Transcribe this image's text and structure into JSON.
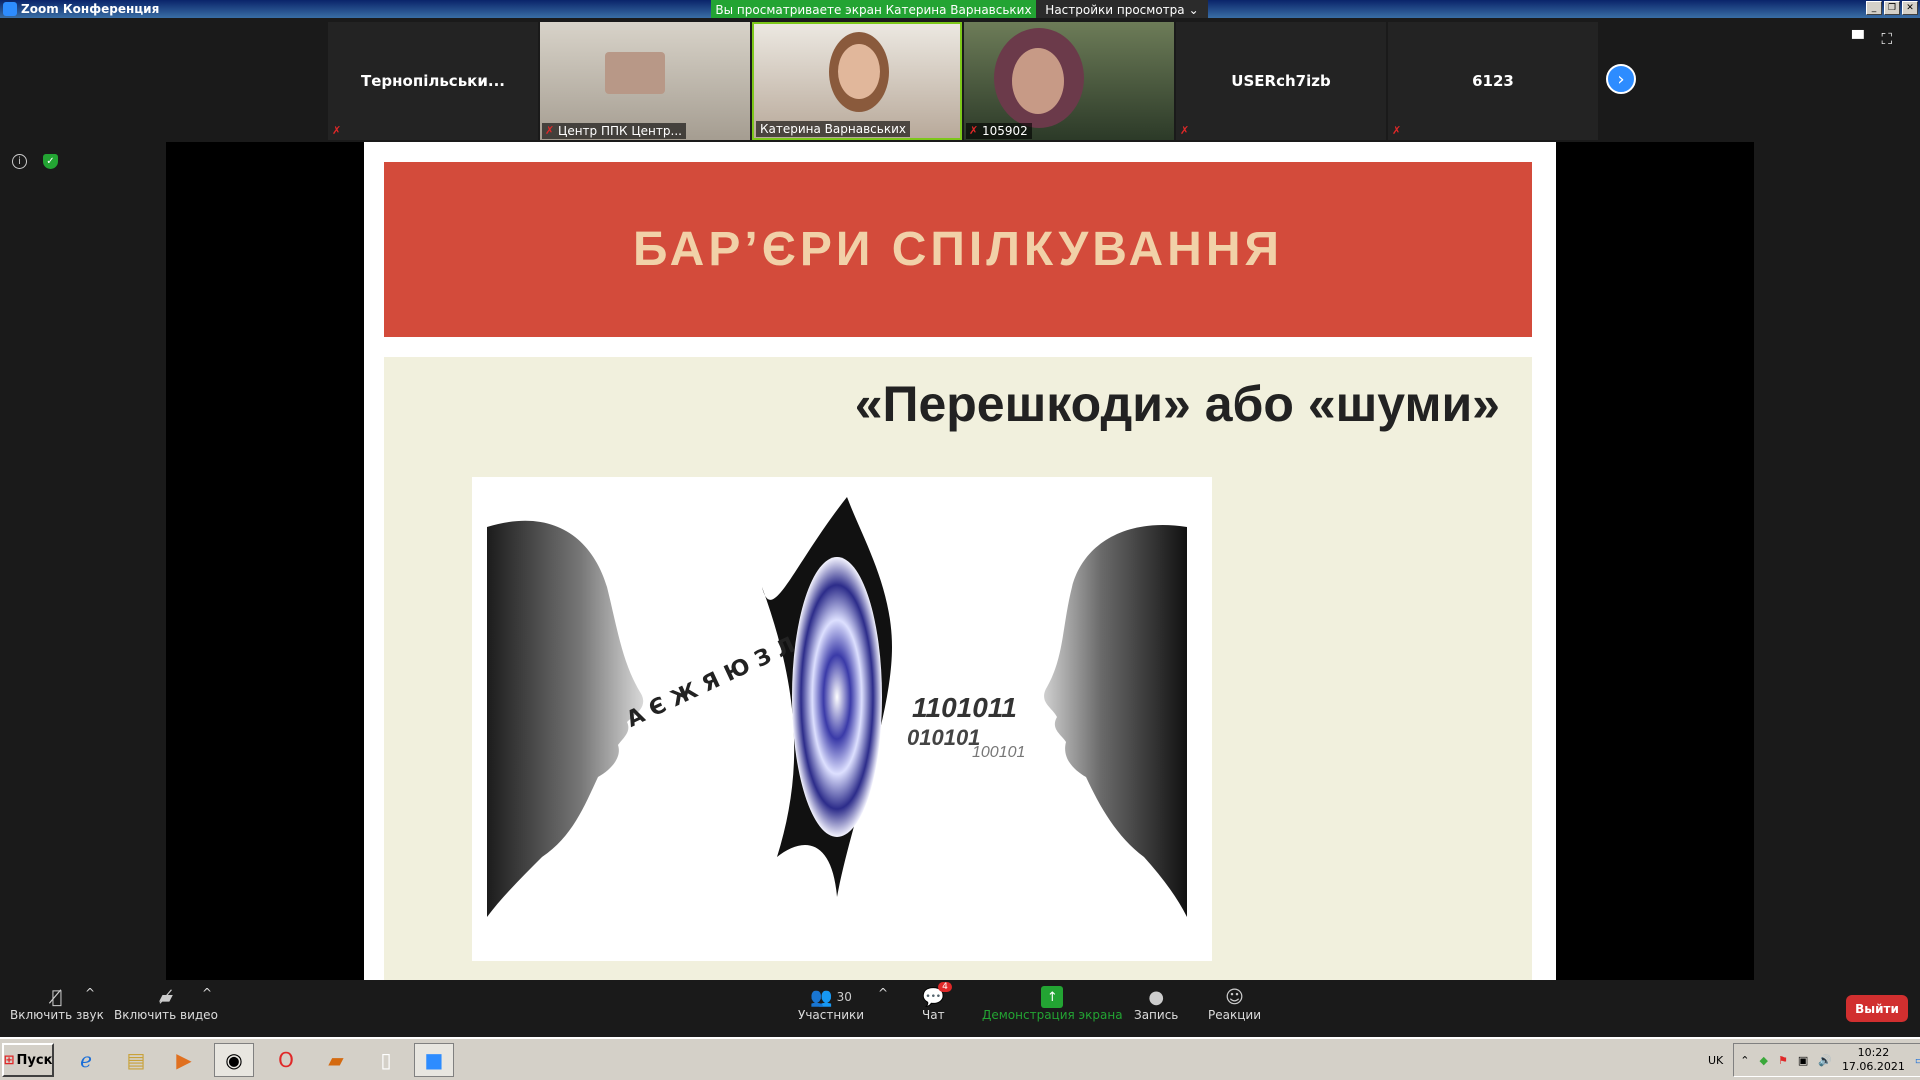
{
  "window": {
    "title": "Zoom Конференция"
  },
  "banner": {
    "text": "Вы просматриваете экран Катерина Варнавських",
    "view_options": "Настройки просмотра"
  },
  "participants_strip": {
    "tiles": [
      {
        "label": "Тернопільськи...",
        "muted": true,
        "video": false
      },
      {
        "label": "Центр ППК Центр...",
        "muted": true,
        "video": true
      },
      {
        "label": "Катерина Варнавських",
        "muted": false,
        "video": true,
        "speaking": true
      },
      {
        "label": "105902",
        "muted": true,
        "video": true
      },
      {
        "label": "USERch7izb",
        "muted": true,
        "video": false
      },
      {
        "label": "6123",
        "muted": true,
        "video": false
      }
    ]
  },
  "slide": {
    "header": "БАР’ЄРИ СПІЛКУВАННЯ",
    "subtitle": "«Перешкоди» або «шуми»",
    "letters": "А Є Ж Я Ю З Л",
    "binary1": "1101011",
    "binary2": "010101",
    "binary3": "100101"
  },
  "toolbar": {
    "audio_label": "Включить звук",
    "video_label": "Включить видео",
    "participants_label": "Участники",
    "participants_count": "30",
    "chat_label": "Чат",
    "chat_badge": "4",
    "share_label": "Демонстрация экрана",
    "record_label": "Запись",
    "reactions_label": "Реакции",
    "leave_label": "Выйти"
  },
  "taskbar": {
    "start_label": "Пуск",
    "lang": "UK",
    "time": "10:22",
    "date": "17.06.2021"
  },
  "colors": {
    "accent": "#2d8cff",
    "share_green": "#23a433",
    "slide_red": "#d34b3b",
    "leave_red": "#d12f2f"
  }
}
